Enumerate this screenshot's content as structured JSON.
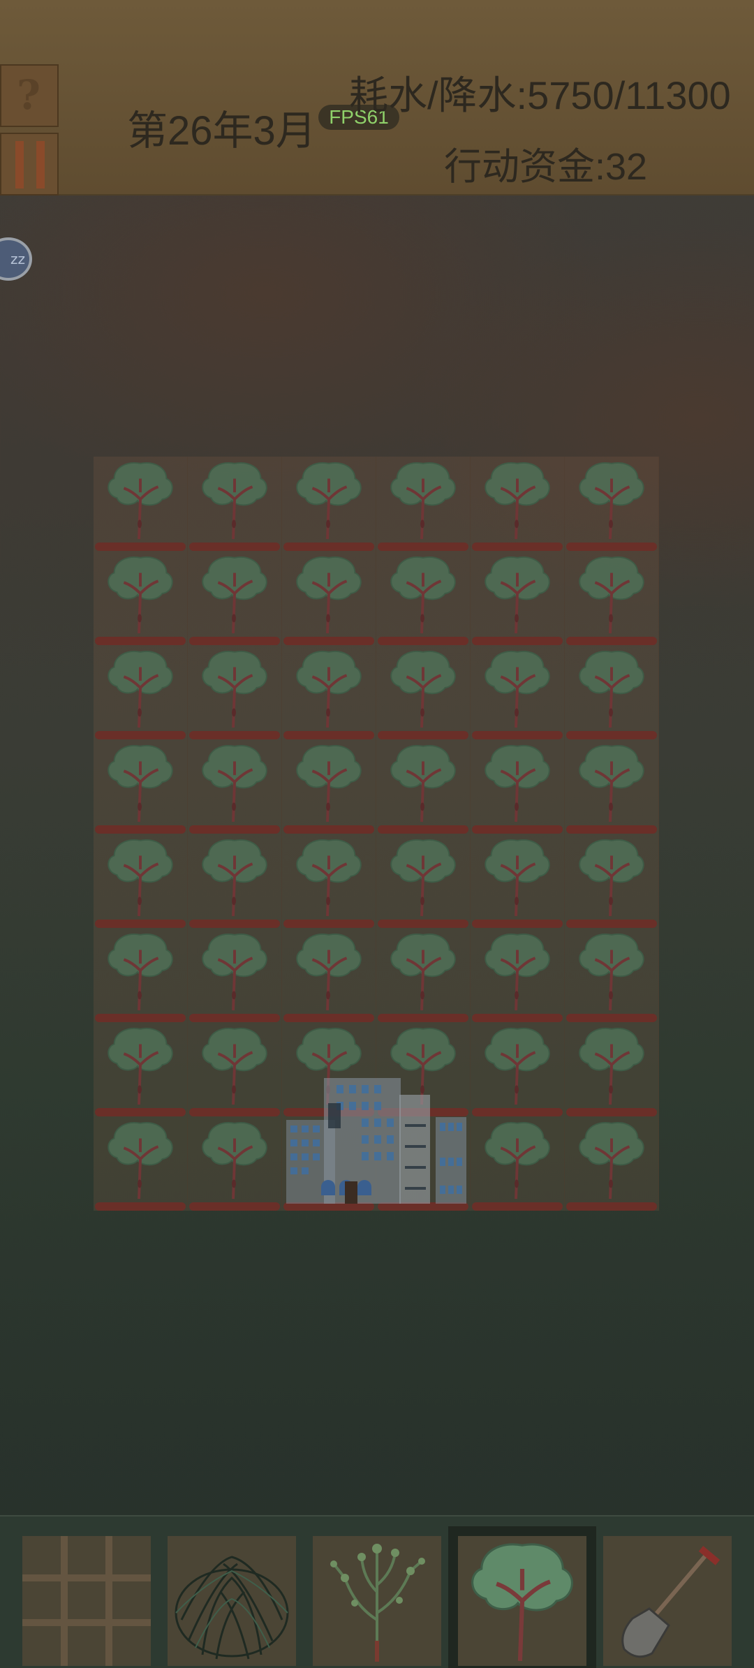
{
  "hud": {
    "date": "第26年3月",
    "fps": "FPS61",
    "water_label": "耗水/降水:5750/11300",
    "funds_label": "行动资金:32",
    "speed_label": "zz"
  },
  "grid": {
    "rows": 8,
    "cols": 6,
    "tile": "tree",
    "building": "city-building"
  },
  "toolbar": {
    "items": [
      {
        "name": "grid-tool",
        "icon": "grid-icon"
      },
      {
        "name": "bush-tool",
        "icon": "bush-icon"
      },
      {
        "name": "sapling-tool",
        "icon": "sapling-icon"
      },
      {
        "name": "tree-tool",
        "icon": "tree-icon",
        "selected": true
      },
      {
        "name": "shovel-tool",
        "icon": "shovel-icon"
      }
    ]
  },
  "colors": {
    "topbar": "#6e5a3a",
    "soil": "#6a2f28",
    "fps_text": "#8fd16a",
    "leaf": "#4f6e55"
  }
}
